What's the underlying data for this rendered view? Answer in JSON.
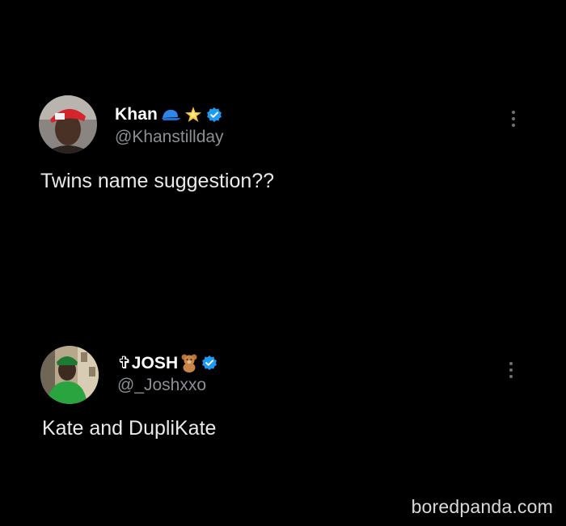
{
  "colors": {
    "background": "#000000",
    "name": "#ffffff",
    "handle": "#8b8f94",
    "text": "#e9eaeb",
    "verified": "#1d9bf0"
  },
  "tweets": [
    {
      "display_name": "Khan",
      "name_emojis": [
        "blue-cap-emoji",
        "glowing-star-emoji"
      ],
      "verified": true,
      "handle": "@Khanstillday",
      "text": "Twins name suggestion??",
      "avatar": "avatar-man-red-cap"
    },
    {
      "display_name": "✞JOSH",
      "name_emojis": [
        "teddy-bear-emoji"
      ],
      "verified": true,
      "handle": "@_Joshxxo",
      "text": "Kate and DupliKate",
      "avatar": "avatar-man-green-outfit"
    }
  ],
  "watermark": "boredpanda.com"
}
